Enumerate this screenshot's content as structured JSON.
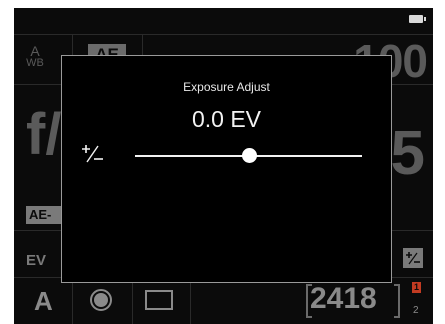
{
  "status": {
    "battery_icon": "battery-icon"
  },
  "background": {
    "wb_top": "A",
    "wb_bottom": "WB",
    "ae_badge": "AE",
    "iso_value": "100",
    "fnumber_prefix": "f/",
    "shutter_digit": "5",
    "ae_lock_label": "AE-",
    "ev_label": "EV",
    "ev_comp_icon": "plus-minus-icon"
  },
  "bottom_bar": {
    "mode": "A",
    "drive_icon": "record-icon",
    "frame_icon": "frame-icon",
    "shots_remaining": "2418",
    "card_primary": "1",
    "card_secondary": "2"
  },
  "dialog": {
    "title": "Exposure Adjust",
    "value_display": "0.0 EV",
    "icon": "plus-minus-icon",
    "slider": {
      "min": -3,
      "max": 3,
      "value": 0.0
    }
  },
  "colors": {
    "card_badge": "#c23b22"
  }
}
